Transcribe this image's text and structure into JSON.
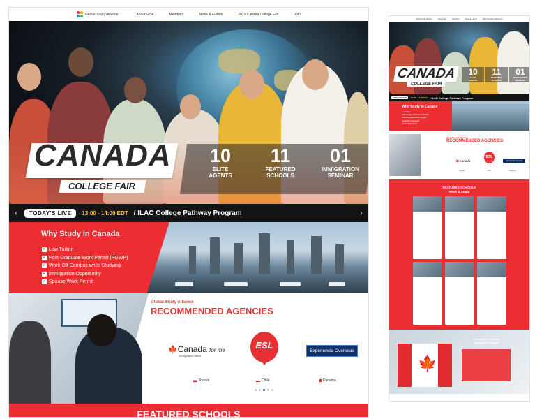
{
  "nav": {
    "brand": "Global Study Alliance",
    "items": [
      "About GSA",
      "Members",
      "News & Events",
      "2020 Canada College Fair",
      "Join"
    ]
  },
  "hero": {
    "title": "CANADA",
    "subtitle": "COLLEGE FAIR",
    "stats": [
      {
        "num": "10",
        "label1": "ELITE",
        "label2": "AGENTS"
      },
      {
        "num": "11",
        "label1": "FEATURED",
        "label2": "SCHOOLS"
      },
      {
        "num": "01",
        "label1": "IMMIGRATION",
        "label2": "SEMINAR"
      }
    ]
  },
  "live": {
    "badge": "TODAY'S LIVE",
    "time": "13:00 - 14:00 EDT",
    "program": "/ ILAC College Pathway Program",
    "prev": "‹",
    "next": "›"
  },
  "why": {
    "title": "Why Study In Canada",
    "items": [
      "Low Tuition",
      "Post Graduate Work Permit (PGWP)",
      "Work-Off Campus while Studying",
      "Immigration Opportunity",
      "Spouse Work Permit"
    ]
  },
  "agencies": {
    "sub": "Global Study Alliance",
    "title": "RECOMMENDED AGENCIES",
    "canada_logo": "Canada",
    "canada_forme": "for me",
    "canada_sub": "Immigration Office",
    "esl": "ESL",
    "exp": "Experiencia Overseas",
    "countries": [
      "Russia",
      "Chile",
      "Panama"
    ]
  },
  "featured": {
    "title": "FEATURED SCHOOLS"
  },
  "mobile": {
    "featured_title1": "FEATURED SCHOOLS",
    "featured_title2": "Work & Study",
    "seminar_title1": "International Students",
    "seminar_title2": "Immigration Seminar"
  }
}
